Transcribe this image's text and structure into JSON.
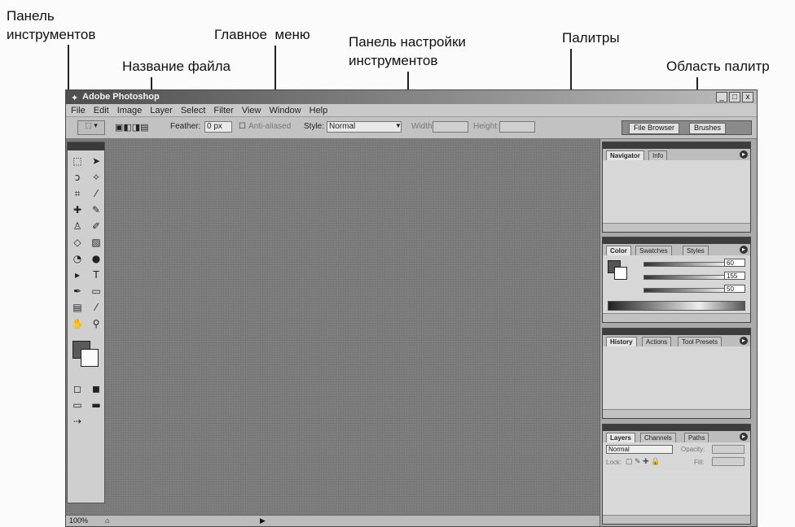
{
  "callouts": {
    "toolbox_line1": "Панель",
    "toolbox_line2": "инструментов",
    "filename": "Название файла",
    "main_menu": "Главное  меню",
    "options_line1": "Панель настройки",
    "options_line2": "инструментов",
    "palettes": "Палитры",
    "palette_well": "Область палитр"
  },
  "app": {
    "title": "Adobe Photoshop",
    "min_symbol": "_",
    "max_symbol": "□",
    "close_symbol": "x"
  },
  "menu": [
    "File",
    "Edit",
    "Image",
    "Layer",
    "Select",
    "Filter",
    "View",
    "Window",
    "Help"
  ],
  "options": {
    "feather_label": "Feather:",
    "feather_value": "0 px",
    "anti_alias_label": "Anti-aliased",
    "style_label": "Style:",
    "style_value": "Normal",
    "width_label": "Width:",
    "height_label": "Height:"
  },
  "well_tabs": [
    "File Browser",
    "Brushes"
  ],
  "palettes": {
    "navigator_tabs": [
      "Navigator",
      "Info"
    ],
    "color_tabs": [
      "Color",
      "Swatches",
      "Styles"
    ],
    "color_values": [
      "60",
      "155",
      "50"
    ],
    "history_tabs": [
      "History",
      "Actions",
      "Tool Presets"
    ],
    "layers_tabs": [
      "Layers",
      "Channels",
      "Paths"
    ],
    "layers_mode": "Normal",
    "layers_opacity_label": "Opacity:",
    "layers_lock_label": "Lock:",
    "layers_fill_label": "Fill:"
  },
  "status": {
    "zoom": "100%"
  }
}
